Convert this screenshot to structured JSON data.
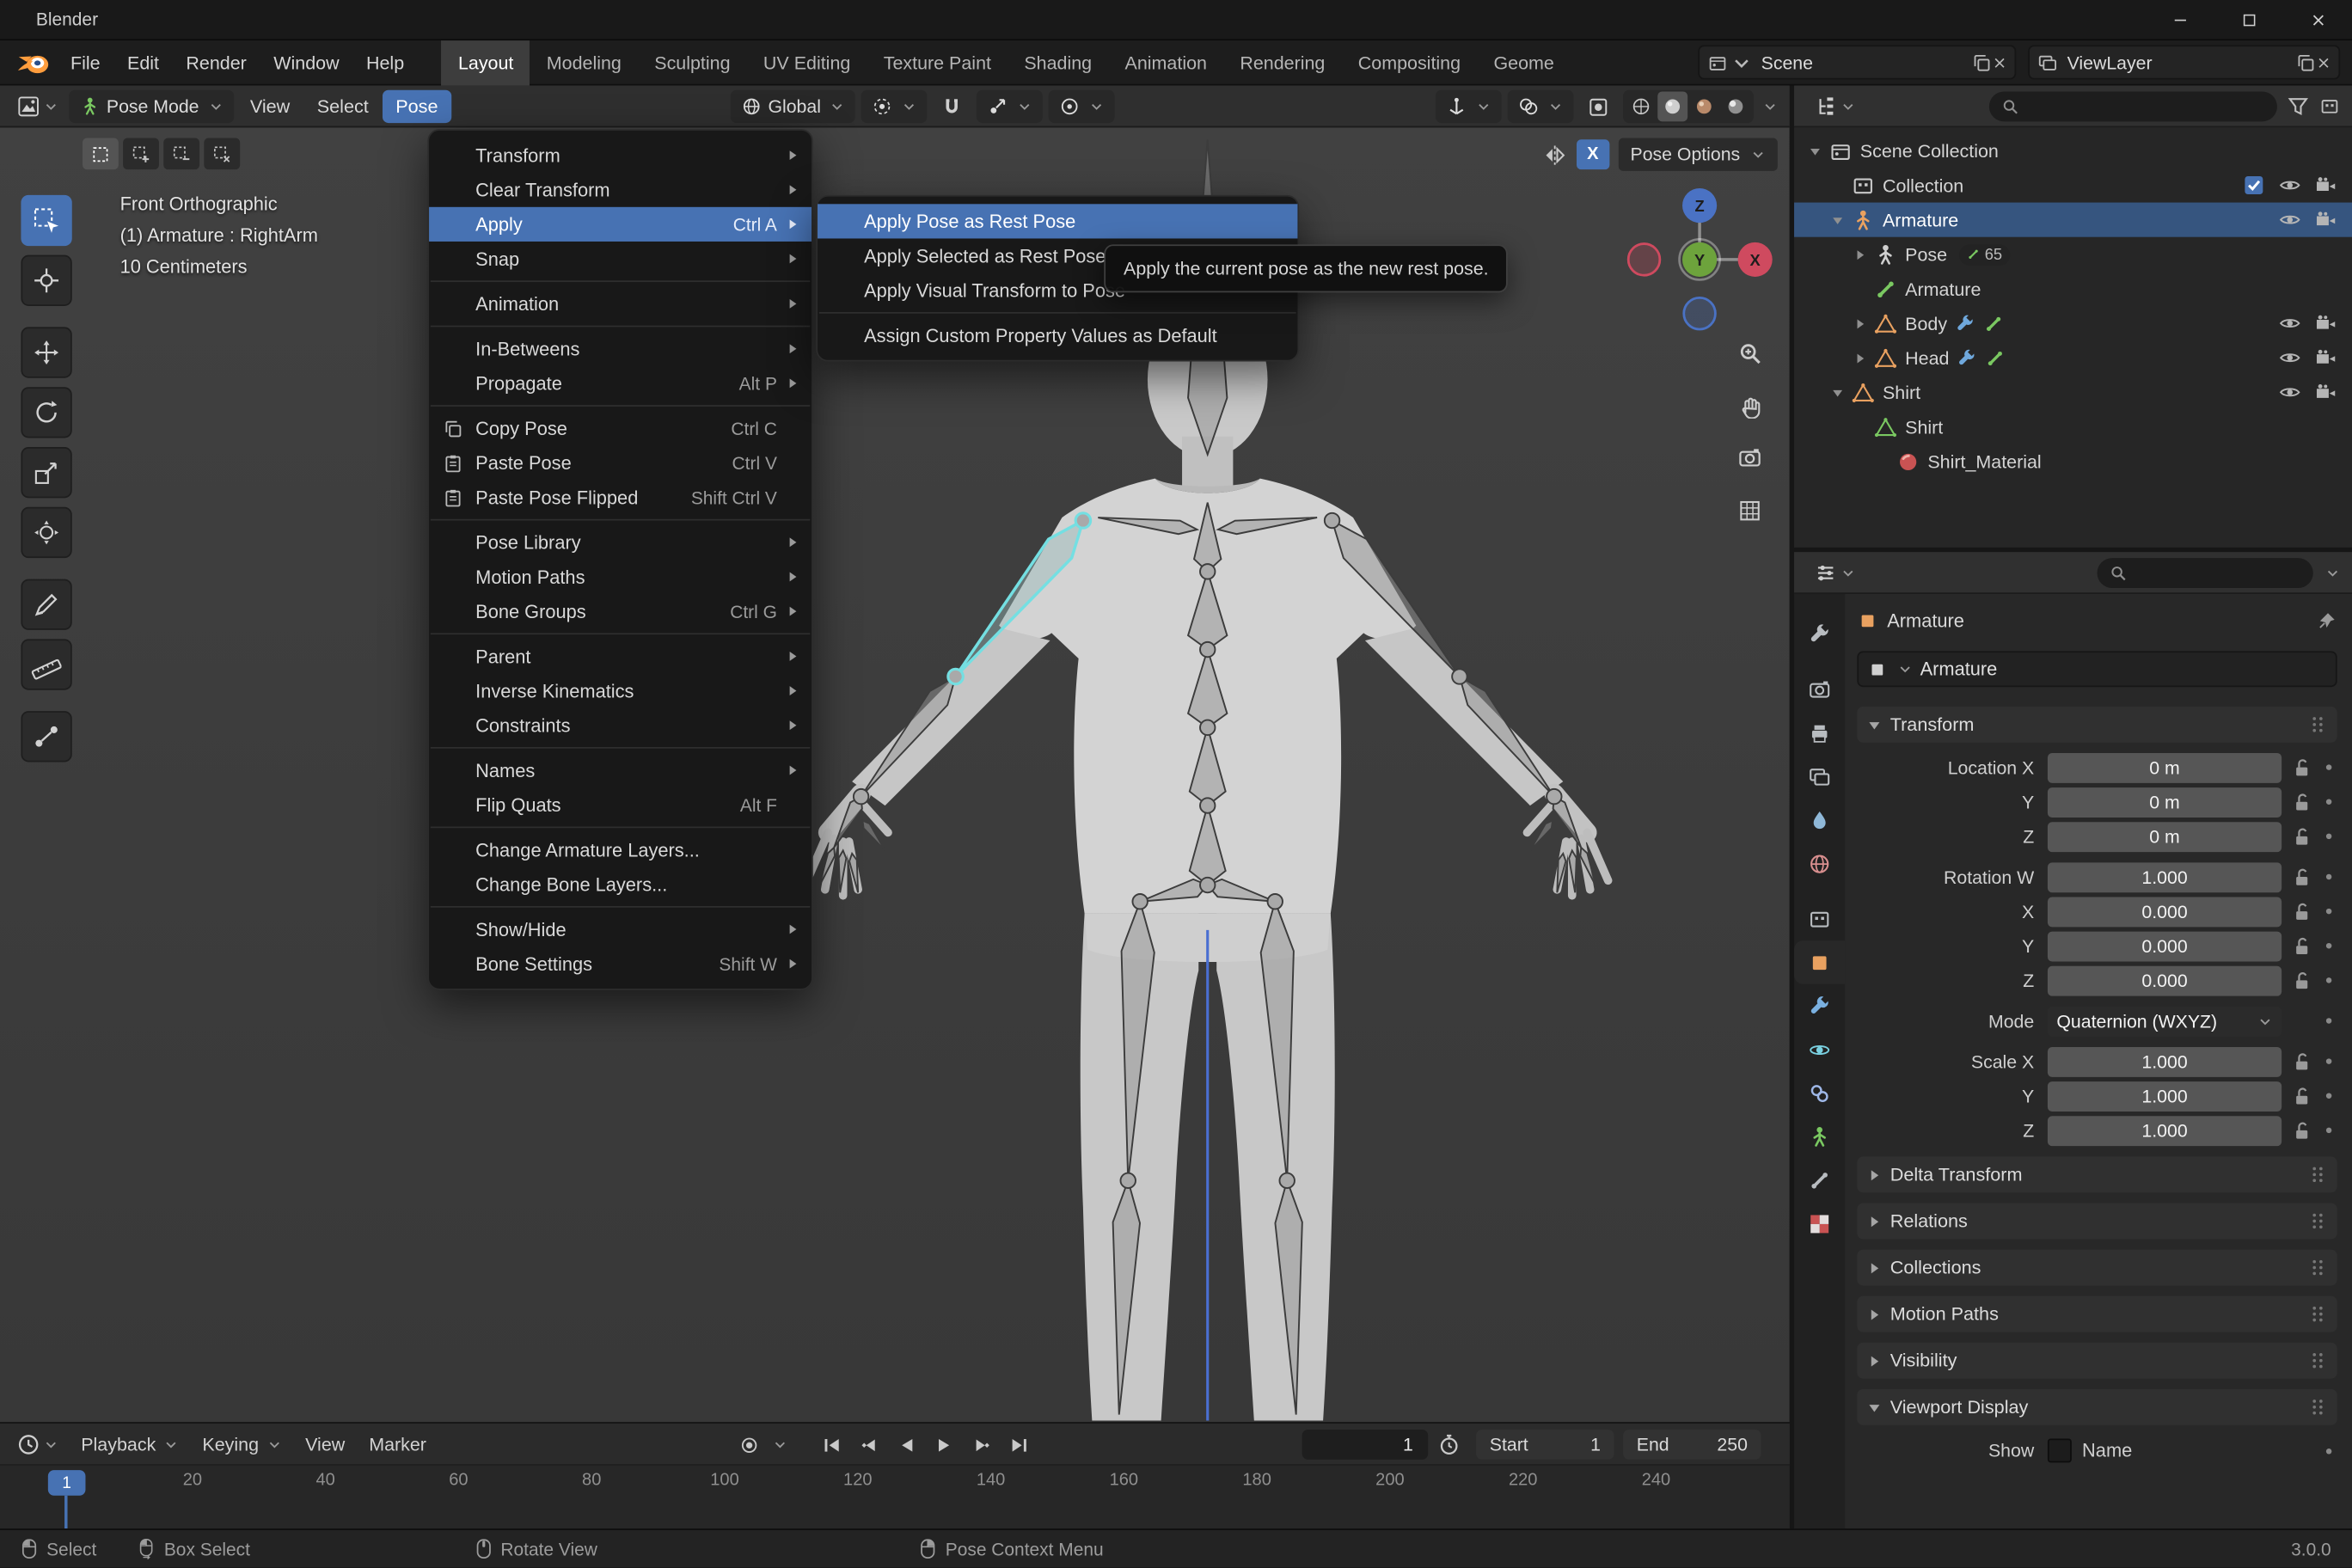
{
  "theme": {
    "accent": "#4772b3",
    "selected_bone": "#74dfe2",
    "outliner_select": "#36557f"
  },
  "titlebar": {
    "app_name": "Blender"
  },
  "topbar": {
    "menus": [
      {
        "label": "File"
      },
      {
        "label": "Edit"
      },
      {
        "label": "Render"
      },
      {
        "label": "Window"
      },
      {
        "label": "Help"
      }
    ],
    "workspaces": [
      {
        "label": "Layout",
        "active": true
      },
      {
        "label": "Modeling"
      },
      {
        "label": "Sculpting"
      },
      {
        "label": "UV Editing"
      },
      {
        "label": "Texture Paint"
      },
      {
        "label": "Shading"
      },
      {
        "label": "Animation"
      },
      {
        "label": "Rendering"
      },
      {
        "label": "Compositing"
      },
      {
        "label": "Geome"
      }
    ],
    "scene_value": "Scene",
    "viewlayer_value": "ViewLayer"
  },
  "viewport_header": {
    "mode_label": "Pose Mode",
    "menus": [
      {
        "label": "View"
      },
      {
        "label": "Select"
      },
      {
        "label": "Pose",
        "active": true
      }
    ],
    "orientation_label": "Global"
  },
  "tool_settings": {
    "select_modes": [
      {
        "icon": "selmode-set",
        "active": true
      },
      {
        "icon": "selmode-extend"
      },
      {
        "icon": "selmode-sub"
      },
      {
        "icon": "selmode-int"
      }
    ],
    "mirror_label": "X",
    "pose_options_label": "Pose Options"
  },
  "viewport": {
    "overlay": [
      "Front Orthographic",
      "(1) Armature : RightArm",
      "10 Centimeters"
    ],
    "gizmo": {
      "x": "X",
      "y": "Y",
      "z": "Z"
    },
    "toolbar": [
      {
        "icon": "tool-select-box",
        "active": true
      },
      {
        "icon": "tool-cursor"
      },
      {
        "icon": "tool-move"
      },
      {
        "icon": "tool-rotate"
      },
      {
        "icon": "tool-scale"
      },
      {
        "icon": "tool-transform"
      },
      {
        "icon": "tool-annotate"
      },
      {
        "icon": "tool-measure"
      },
      {
        "icon": "tool-breakdowner"
      }
    ],
    "toolbar_gaps_after": [
      1,
      5,
      7
    ],
    "nav_buttons": [
      {
        "icon": "zoomicon"
      },
      {
        "icon": "hand"
      },
      {
        "icon": "camback"
      },
      {
        "icon": "gridicon"
      }
    ]
  },
  "pose_menu": {
    "items": [
      {
        "label": "Transform",
        "submenu": true
      },
      {
        "label": "Clear Transform",
        "submenu": true
      },
      {
        "label": "Apply",
        "shortcut": "Ctrl A",
        "submenu": true,
        "highlight": true
      },
      {
        "label": "Snap",
        "submenu": true
      },
      {
        "sep": true
      },
      {
        "label": "Animation",
        "submenu": true
      },
      {
        "sep": true
      },
      {
        "label": "In-Betweens",
        "submenu": true
      },
      {
        "label": "Propagate",
        "shortcut": "Alt P",
        "submenu": true
      },
      {
        "sep": true
      },
      {
        "label": "Copy Pose",
        "shortcut": "Ctrl C",
        "icon": "copy"
      },
      {
        "label": "Paste Pose",
        "shortcut": "Ctrl V",
        "icon": "paste"
      },
      {
        "label": "Paste Pose Flipped",
        "shortcut": "Shift Ctrl V",
        "icon": "paste"
      },
      {
        "sep": true
      },
      {
        "label": "Pose Library",
        "submenu": true
      },
      {
        "label": "Motion Paths",
        "submenu": true
      },
      {
        "label": "Bone Groups",
        "shortcut": "Ctrl G",
        "submenu": true
      },
      {
        "sep": true
      },
      {
        "label": "Parent",
        "submenu": true
      },
      {
        "label": "Inverse Kinematics",
        "submenu": true
      },
      {
        "label": "Constraints",
        "submenu": true
      },
      {
        "sep": true
      },
      {
        "label": "Names",
        "submenu": true
      },
      {
        "label": "Flip Quats",
        "shortcut": "Alt F"
      },
      {
        "sep": true
      },
      {
        "label": "Change Armature Layers..."
      },
      {
        "label": "Change Bone Layers..."
      },
      {
        "sep": true
      },
      {
        "label": "Show/Hide",
        "submenu": true
      },
      {
        "label": "Bone Settings",
        "shortcut": "Shift W",
        "submenu": true
      }
    ]
  },
  "apply_submenu": {
    "items": [
      {
        "label": "Apply Pose as Rest Pose",
        "highlight": true
      },
      {
        "label": "Apply Selected as Rest Pose"
      },
      {
        "label": "Apply Visual Transform to Pose"
      },
      {
        "sep": true
      },
      {
        "label": "Assign Custom Property Values as Default"
      }
    ]
  },
  "tooltip": {
    "text": "Apply the current pose as the new rest pose."
  },
  "outliner": {
    "rows": [
      {
        "depth": 0,
        "exp": "down",
        "icon": "scene",
        "label": "Scene Collection"
      },
      {
        "depth": 1,
        "exp": "none",
        "icon": "collection",
        "label": "Collection",
        "right": [
          "checkbox",
          "eye",
          "camera"
        ]
      },
      {
        "depth": 1,
        "exp": "down",
        "icon": "armature-object",
        "label": "Armature",
        "selected": true,
        "right": [
          "eye",
          "camera"
        ]
      },
      {
        "depth": 2,
        "exp": "right",
        "icon": "pose",
        "label": "Pose",
        "badge": "65"
      },
      {
        "depth": 2,
        "exp": "none",
        "icon": "armature-data",
        "label": "Armature"
      },
      {
        "depth": 2,
        "exp": "right",
        "icon": "mesh-object",
        "label": "Body",
        "extras": [
          "modifier",
          "armature-mini"
        ],
        "right": [
          "eye",
          "camera"
        ]
      },
      {
        "depth": 2,
        "exp": "right",
        "icon": "mesh-object",
        "label": "Head",
        "extras": [
          "modifier",
          "armature-mini"
        ],
        "right": [
          "eye",
          "camera"
        ]
      },
      {
        "depth": 1,
        "exp": "down",
        "icon": "mesh-object",
        "label": "Shirt",
        "right": [
          "eye",
          "camera"
        ]
      },
      {
        "depth": 2,
        "exp": "none",
        "icon": "mesh-data",
        "label": "Shirt"
      },
      {
        "depth": 3,
        "exp": "none",
        "icon": "material",
        "label": "Shirt_Material"
      }
    ]
  },
  "properties": {
    "object_name": "Armature",
    "id_name": "Armature",
    "tabs": [
      {
        "icon": "tab-tool",
        "color": "#b8bcc0"
      },
      {
        "icon": "tab-render",
        "color": "#b8bcc0"
      },
      {
        "icon": "tab-output",
        "color": "#b8bcc0"
      },
      {
        "icon": "tab-viewlayer",
        "color": "#b8bcc0"
      },
      {
        "icon": "tab-scene",
        "color": "#8fb8d8"
      },
      {
        "icon": "tab-world",
        "color": "#d98f8f"
      },
      {
        "icon": "tab-collection",
        "color": "#b8bcc0"
      },
      {
        "icon": "tab-object",
        "color": "#e9a160",
        "active": true
      },
      {
        "icon": "tab-modifier",
        "color": "#7ab0e0"
      },
      {
        "icon": "tab-physics",
        "color": "#7ad0e0"
      },
      {
        "icon": "tab-constraint",
        "color": "#9fb8e8"
      },
      {
        "icon": "tab-data",
        "color": "#7ac861"
      },
      {
        "icon": "tab-bone",
        "color": "#b8bcc0"
      },
      {
        "icon": "tab-texture",
        "color": "#d98f8f"
      }
    ],
    "tabs_gaps_after": [
      0,
      5
    ],
    "transform": {
      "title": "Transform",
      "groups": [
        {
          "rows": [
            {
              "label": "Location X",
              "value": "0 m"
            },
            {
              "label": "Y",
              "value": "0 m"
            },
            {
              "label": "Z",
              "value": "0 m"
            }
          ]
        },
        {
          "rows": [
            {
              "label": "Rotation W",
              "value": "1.000"
            },
            {
              "label": "X",
              "value": "0.000"
            },
            {
              "label": "Y",
              "value": "0.000"
            },
            {
              "label": "Z",
              "value": "0.000"
            }
          ]
        },
        {
          "rows": [
            {
              "label": "Mode",
              "value": "Quaternion (WXYZ)",
              "dropdown": true
            }
          ]
        },
        {
          "rows": [
            {
              "label": "Scale X",
              "value": "1.000"
            },
            {
              "label": "Y",
              "value": "1.000"
            },
            {
              "label": "Z",
              "value": "1.000"
            }
          ]
        }
      ]
    },
    "collapsed_sections": [
      "Delta Transform",
      "Relations",
      "Collections",
      "Motion Paths",
      "Visibility"
    ],
    "viewport_display": {
      "title": "Viewport Display",
      "show_label": "Show",
      "name_label": "Name"
    }
  },
  "timeline": {
    "menus": [
      {
        "label": "Playback",
        "chev": true
      },
      {
        "label": "Keying",
        "chev": true
      },
      {
        "label": "View"
      },
      {
        "label": "Marker"
      }
    ],
    "frame_field": "1",
    "start_label": "Start",
    "start_value": "1",
    "end_label": "End",
    "end_value": "250",
    "ruler": [
      20,
      40,
      60,
      80,
      100,
      120,
      140,
      160,
      180,
      200,
      220,
      240
    ],
    "playhead_label": "1"
  },
  "statusbar": {
    "hints": [
      {
        "icon": "mouse-lmb",
        "label": "Select"
      },
      {
        "icon": "mouse-drag",
        "label": "Box Select"
      },
      {
        "icon": "mouse-mmb",
        "label": "Rotate View"
      },
      {
        "icon": "mouse-rmb",
        "label": "Pose Context Menu"
      }
    ],
    "version": "3.0.0"
  }
}
